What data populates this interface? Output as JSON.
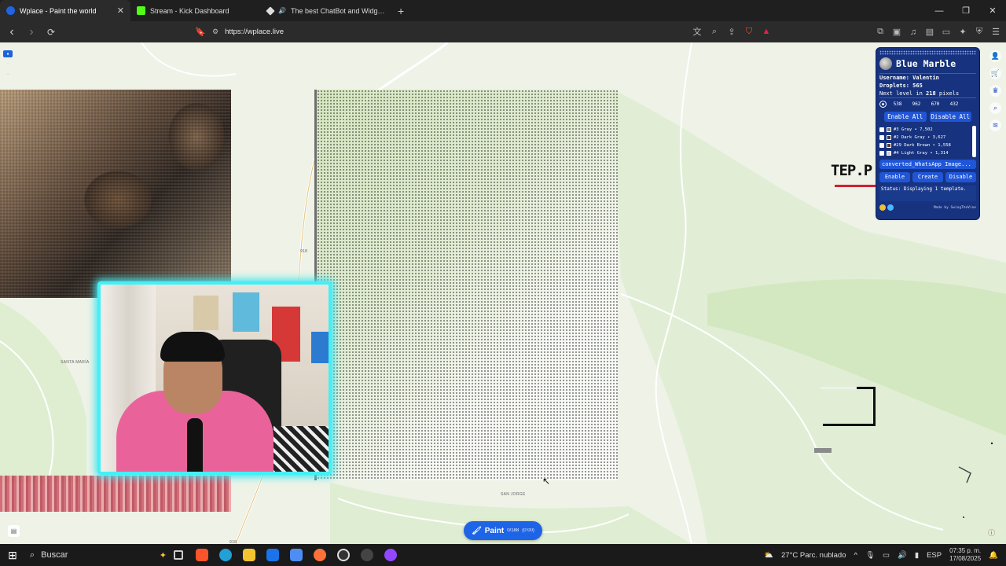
{
  "tabs": [
    {
      "title": "Wplace - Paint the world",
      "color": "#1e64e6",
      "active": true
    },
    {
      "title": "Stream - Kick Dashboard",
      "color": "#53fc18",
      "active": false
    },
    {
      "title": "The best ChatBot and Widgets fo",
      "color": "#dddddd",
      "active": false
    }
  ],
  "browser": {
    "url": "https://wplace.live",
    "new_tab": "+",
    "back": "‹",
    "forward": "›",
    "reload": "⟳"
  },
  "window": {
    "minimize": "—",
    "maximize": "❐",
    "close": "✕"
  },
  "map": {
    "labels": [
      {
        "text": "SANTA MARÍA"
      },
      {
        "text": "SAN JORGE"
      },
      {
        "text": "918"
      },
      {
        "text": "918"
      }
    ],
    "overlay_text": "TEP.P"
  },
  "paint_button": {
    "label": "Paint",
    "count": "0/188",
    "timer": "(0:00)"
  },
  "blue_marble": {
    "title": "Blue Marble",
    "username_label": "Username:",
    "username": "Valentin",
    "droplets_label": "Droplets:",
    "droplets": "565",
    "next_level_prefix": "Next level in",
    "next_level_value": "218",
    "next_level_suffix": "pixels",
    "coords": [
      "538",
      "962",
      "670",
      "432"
    ],
    "enable_all": "Enable All",
    "disable_all": "Disable All",
    "colors": [
      {
        "label": "#3 Gray • 7,502",
        "swatch": "#787878"
      },
      {
        "label": "#2 Dark Gray • 3,627",
        "swatch": "#3c3c3c"
      },
      {
        "label": "#29 Dark Brown • 1,558",
        "swatch": "#5b3b26"
      },
      {
        "label": "#4 Light Gray • 1,314",
        "swatch": "#d2d2d2"
      }
    ],
    "file_name": "converted_WhatsApp Image...",
    "enable": "Enable",
    "create": "Create",
    "disable": "Disable",
    "status": "Status: Displaying 1 template.",
    "made_by": "Made by SwingTheVine"
  },
  "taskbar": {
    "search_placeholder": "Buscar",
    "weather": "27°C  Parc. nublado",
    "language": "ESP",
    "time": "07:35 p. m.",
    "date": "17/08/2025"
  }
}
